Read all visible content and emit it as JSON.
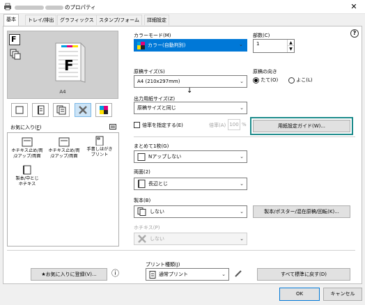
{
  "window": {
    "title": "のプロパティ",
    "close_glyph": "✕"
  },
  "tabs": [
    "基本",
    "トレイ/排出",
    "グラフィックス",
    "スタンプ/フォーム",
    "詳細設定"
  ],
  "preview": {
    "paper": "A4",
    "page_letter": "F",
    "badge_letter": "F"
  },
  "favorites": {
    "label": "お気に入り(",
    "label_key": "F",
    "label_end": ")",
    "items": [
      {
        "line1": "ホチキス止め/両",
        "line2": "/2アップ/両面"
      },
      {
        "line1": "ホチキス止め/両",
        "line2": "/2アップ/両面"
      },
      {
        "line1": "手書しはがき",
        "line2": "プリント"
      },
      {
        "line1": "製本/中とじ",
        "line2": "ホチキス"
      }
    ]
  },
  "color_mode": {
    "label": "カラーモード(M)",
    "value": "カラー(自動判別)"
  },
  "copies": {
    "label": "部数(C)",
    "value": "1"
  },
  "original_size": {
    "label": "原稿サイズ(S)",
    "value": "A4 (210x297mm)"
  },
  "orientation": {
    "label": "原稿の向き",
    "portrait": "たて(O)",
    "landscape": "よこ(L)"
  },
  "arrow_down": "↓",
  "output_size": {
    "label": "出力用紙サイズ(Z)",
    "value": "原稿サイズと同じ"
  },
  "scale": {
    "checkbox_label": "倍率を指定する(E)",
    "ratio_label": "倍率(A)",
    "value": "100",
    "unit": "%"
  },
  "paper_guide_button": "用紙設定ガイド(W)...",
  "nup": {
    "label": "まとめて1枚(G)",
    "value": "Nアップしない"
  },
  "duplex": {
    "label": "両面(2)",
    "value": "長辺とじ"
  },
  "booklet": {
    "label": "製本(B)",
    "value": "しない",
    "button": "製本/ポスター/混在原稿/回転(K)..."
  },
  "staple": {
    "label": "ホチキス(P)",
    "value": "しない"
  },
  "print_type": {
    "label": "プリント種類(J)",
    "value": "通常プリント"
  },
  "add_favorite_button": "お気に入りに登録(V)...",
  "reset_button": "すべて標準に戻す(D)",
  "ok_button": "OK",
  "cancel_button": "キャンセル",
  "help_glyph": "?",
  "info_glyph": "ⓘ"
}
